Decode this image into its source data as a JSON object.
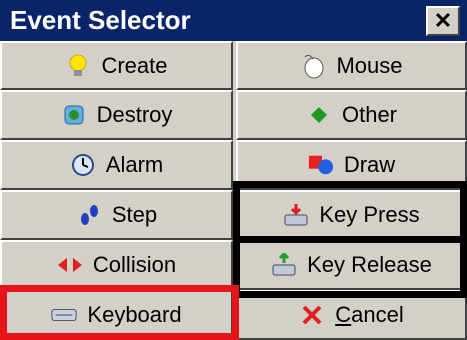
{
  "window": {
    "title": "Event Selector",
    "close_label": "✕"
  },
  "buttons": {
    "create": {
      "label": "Create",
      "icon": "lightbulb-icon"
    },
    "mouse": {
      "label": "Mouse",
      "icon": "mouse-icon"
    },
    "destroy": {
      "label": "Destroy",
      "icon": "trash-icon"
    },
    "other": {
      "label": "Other",
      "icon": "green-diamond-icon"
    },
    "alarm": {
      "label": "Alarm",
      "icon": "clock-icon"
    },
    "draw": {
      "label": "Draw",
      "icon": "shapes-icon"
    },
    "step": {
      "label": "Step",
      "icon": "footsteps-icon"
    },
    "key_press": {
      "label": "Key Press",
      "icon": "key-press-icon"
    },
    "collision": {
      "label": "Collision",
      "icon": "collision-arrows-icon"
    },
    "key_release": {
      "label": "Key Release",
      "icon": "key-release-icon"
    },
    "keyboard": {
      "label": "Keyboard",
      "icon": "keyboard-icon"
    },
    "cancel": {
      "label_first": "C",
      "label_rest": "ancel",
      "icon": "red-x-icon"
    }
  },
  "colors": {
    "title_bar": "#0a246a",
    "face": "#d4d0c8",
    "highlight_red": "#e8141c",
    "highlight_black": "#000000"
  }
}
